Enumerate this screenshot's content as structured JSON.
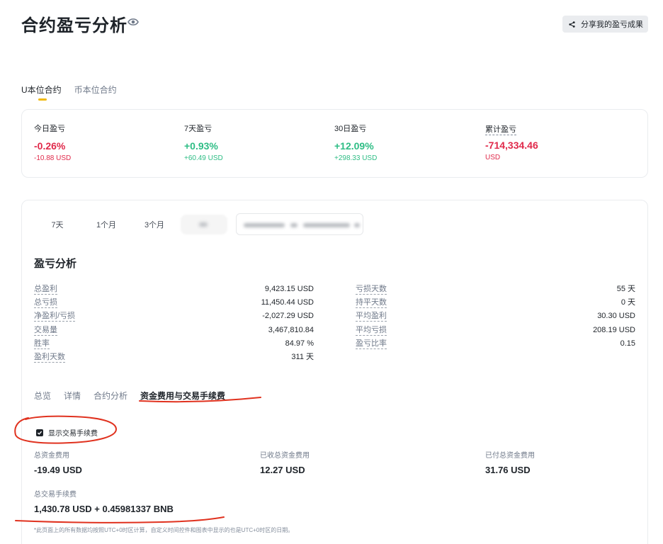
{
  "header": {
    "title": "合约盈亏分析",
    "share_label": "分享我的盈亏成果"
  },
  "contract_tabs": [
    {
      "label": "U本位合约",
      "active": true
    },
    {
      "label": "币本位合约",
      "active": false
    }
  ],
  "summary": {
    "today": {
      "label": "今日盈亏",
      "pct": "-0.26%",
      "usd": "-10.88 USD"
    },
    "week": {
      "label": "7天盈亏",
      "pct": "+0.93%",
      "usd": "+60.49 USD"
    },
    "month": {
      "label": "30日盈亏",
      "pct": "+12.09%",
      "usd": "+298.33 USD"
    },
    "total": {
      "label": "累计盈亏",
      "value": "-714,334.46",
      "unit": "USD"
    }
  },
  "range_buttons": [
    "7天",
    "1个月",
    "3个月"
  ],
  "analysis": {
    "title": "盈亏分析",
    "left": [
      {
        "label": "总盈利",
        "value": "9,423.15 USD"
      },
      {
        "label": "总亏损",
        "value": "11,450.44 USD"
      },
      {
        "label": "净盈利/亏损",
        "value": "-2,027.29 USD"
      },
      {
        "label": "交易量",
        "value": "3,467,810.84"
      },
      {
        "label": "胜率",
        "value": "84.97 %"
      },
      {
        "label": "盈利天数",
        "value": "311 天"
      }
    ],
    "right": [
      {
        "label": "亏损天数",
        "value": "55 天"
      },
      {
        "label": "持平天数",
        "value": "0 天"
      },
      {
        "label": "平均盈利",
        "value": "30.30 USD"
      },
      {
        "label": "平均亏损",
        "value": "208.19 USD"
      },
      {
        "label": "盈亏比率",
        "value": "0.15"
      }
    ]
  },
  "sub_tabs": [
    {
      "label": "总览",
      "active": false
    },
    {
      "label": "详情",
      "active": false
    },
    {
      "label": "合约分析",
      "active": false
    },
    {
      "label": "资金费用与交易手续费",
      "active": true
    }
  ],
  "fees": {
    "show_fee_label": "显示交易手续费",
    "show_fee_checked": true,
    "total_funding": {
      "label": "总资金费用",
      "value": "-19.49 USD"
    },
    "received_funding": {
      "label": "已收总资金费用",
      "value": "12.27 USD"
    },
    "paid_funding": {
      "label": "已付总资金费用",
      "value": "31.76 USD"
    },
    "total_trading_fee": {
      "label": "总交易手续费",
      "value": "1,430.78 USD + 0.45981337 BNB"
    }
  },
  "footnote": "*此页面上的所有数据均按照UTC+0时区计算，自定义时间控件和图表中显示的也是UTC+0时区的日期。",
  "colors": {
    "negative": "#e0294a",
    "positive": "#2ebd85",
    "accent": "#f0b90b",
    "annotation": "#e0321f"
  }
}
